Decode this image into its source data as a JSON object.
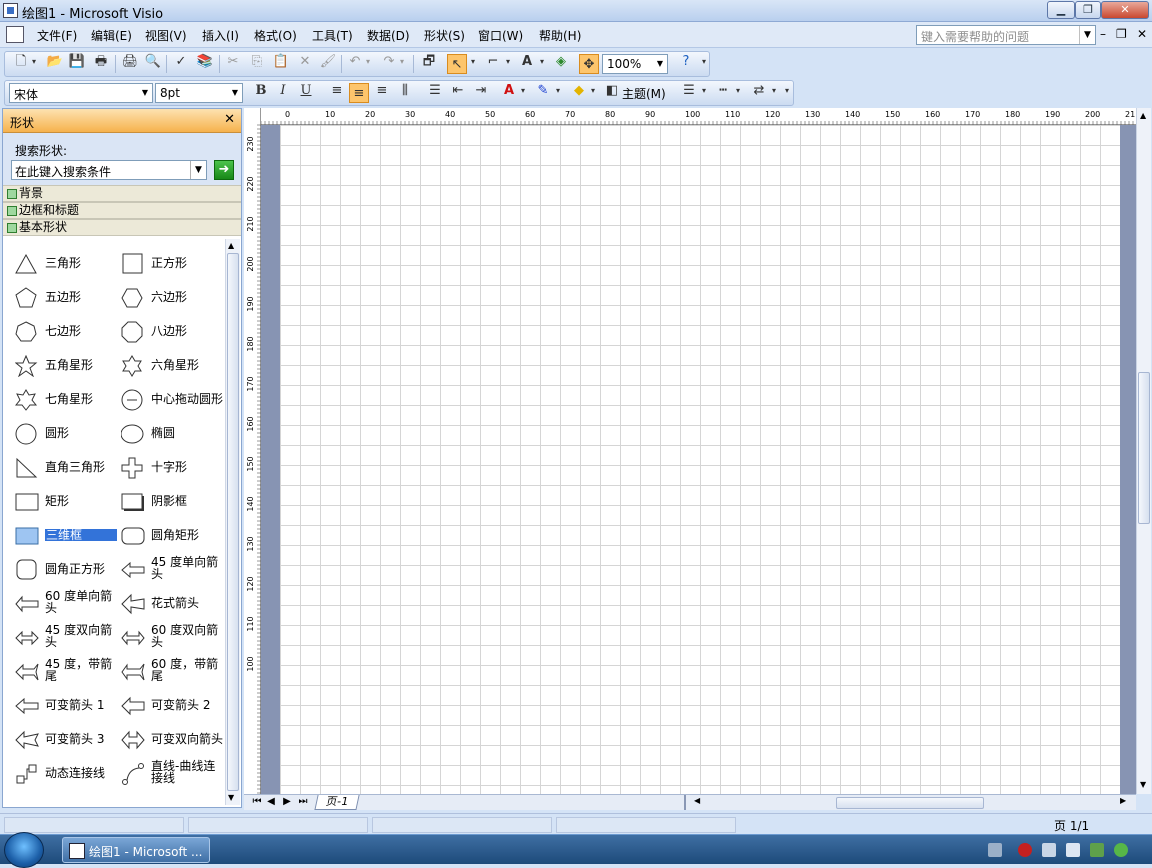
{
  "window": {
    "title": "绘图1 - Microsoft Visio",
    "min": "▁",
    "max": "❐",
    "close": "✕"
  },
  "menu": [
    "文件(F)",
    "编辑(E)",
    "视图(V)",
    "插入(I)",
    "格式(O)",
    "工具(T)",
    "数据(D)",
    "形状(S)",
    "窗口(W)",
    "帮助(H)"
  ],
  "help": {
    "placeholder": "键入需要帮助的问题"
  },
  "toolbar": {
    "zoom": "100%",
    "font": "宋体",
    "size": "8pt",
    "theme": "主题(M)"
  },
  "panel": {
    "title": "形状",
    "search_label": "搜索形状:",
    "search_placeholder": "在此键入搜索条件",
    "stencils": [
      "背景",
      "边框和标题",
      "基本形状"
    ],
    "shapes": [
      {
        "label": "三角形",
        "icon": "triangle"
      },
      {
        "label": "正方形",
        "icon": "square"
      },
      {
        "label": "五边形",
        "icon": "pentagon"
      },
      {
        "label": "六边形",
        "icon": "hexagon"
      },
      {
        "label": "七边形",
        "icon": "heptagon"
      },
      {
        "label": "八边形",
        "icon": "octagon"
      },
      {
        "label": "五角星形",
        "icon": "star5"
      },
      {
        "label": "六角星形",
        "icon": "star6"
      },
      {
        "label": "七角星形",
        "icon": "star7"
      },
      {
        "label": "中心拖动圆形",
        "icon": "circle-center"
      },
      {
        "label": "圆形",
        "icon": "circle"
      },
      {
        "label": "椭圆",
        "icon": "ellipse"
      },
      {
        "label": "直角三角形",
        "icon": "right-triangle"
      },
      {
        "label": "十字形",
        "icon": "cross"
      },
      {
        "label": "矩形",
        "icon": "rectangle"
      },
      {
        "label": "阴影框",
        "icon": "shadow-box"
      },
      {
        "label": "三维框",
        "icon": "3d-box"
      },
      {
        "label": "圆角矩形",
        "icon": "rounded-rect"
      },
      {
        "label": "圆角正方形",
        "icon": "rounded-square"
      },
      {
        "label": "45 度单向箭头",
        "icon": "arrow-45"
      },
      {
        "label": "60 度单向箭头",
        "icon": "arrow-60"
      },
      {
        "label": "花式箭头",
        "icon": "fancy-arrow"
      },
      {
        "label": "45 度双向箭头",
        "icon": "double-arrow-45"
      },
      {
        "label": "60 度双向箭头",
        "icon": "double-arrow-60"
      },
      {
        "label": "45 度，带箭尾",
        "icon": "tail-arrow-45"
      },
      {
        "label": "60 度，带箭尾",
        "icon": "tail-arrow-60"
      },
      {
        "label": "可变箭头 1",
        "icon": "var-arrow-1"
      },
      {
        "label": "可变箭头 2",
        "icon": "var-arrow-2"
      },
      {
        "label": "可变箭头 3",
        "icon": "var-arrow-3"
      },
      {
        "label": "可变双向箭头",
        "icon": "var-double-arrow"
      },
      {
        "label": "动态连接线",
        "icon": "dynamic-connector"
      },
      {
        "label": "直线-曲线连接线",
        "icon": "line-curve-connector"
      }
    ]
  },
  "ruler": {
    "top": [
      "0",
      "10",
      "20",
      "30",
      "40",
      "50",
      "60",
      "70",
      "80",
      "90",
      "100",
      "110",
      "120",
      "130",
      "140",
      "150",
      "160",
      "170",
      "180",
      "190",
      "200",
      "21"
    ],
    "left": [
      "230",
      "220",
      "210",
      "200",
      "190",
      "180",
      "170",
      "160",
      "150",
      "140",
      "130",
      "120",
      "110",
      "100"
    ]
  },
  "pages": {
    "tab": "页-1",
    "indicator": "页 1/1"
  },
  "taskbar": {
    "item": "绘图1 - Microsoft ..."
  }
}
